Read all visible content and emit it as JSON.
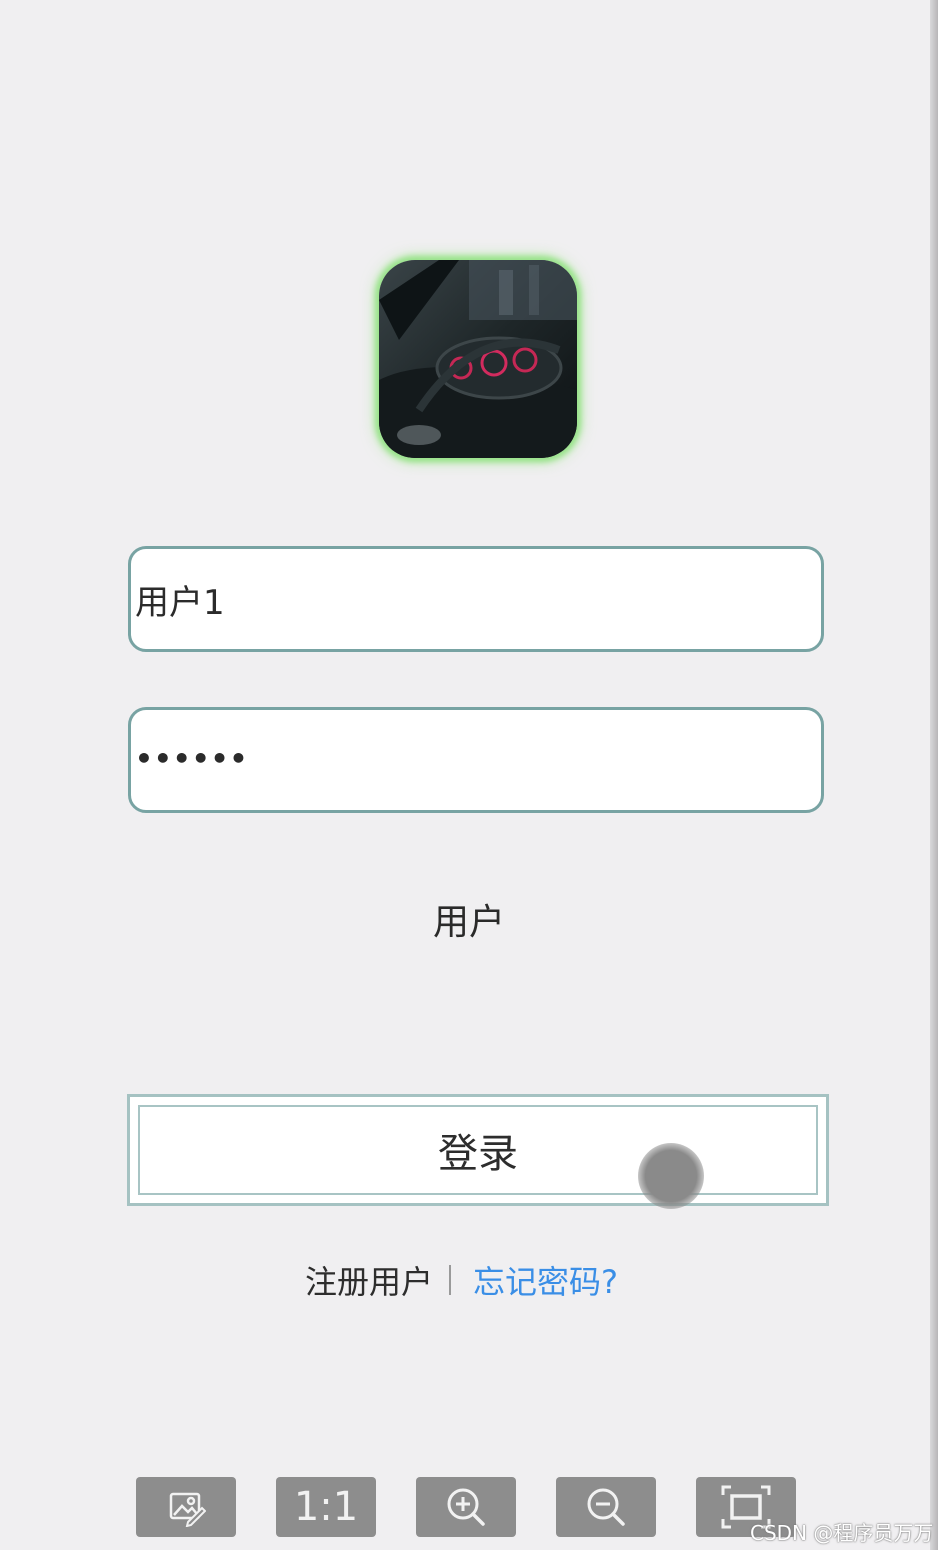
{
  "login": {
    "username_value": "用户1",
    "password_value": "••••••",
    "role_label": "用户",
    "login_button": "登录",
    "register_link": "注册用户",
    "forgot_link": "忘记密码?"
  },
  "viewer_toolbar": {
    "buttons": [
      {
        "icon": "image-edit-icon"
      },
      {
        "label": "1:1"
      },
      {
        "icon": "zoom-in-icon"
      },
      {
        "icon": "zoom-out-icon"
      },
      {
        "icon": "fit-screen-icon"
      }
    ]
  },
  "watermark": "CSDN @程序员万万",
  "colors": {
    "input_border": "#78a3a3",
    "avatar_glow": "#98e38a",
    "link_blue": "#3a8ee6",
    "toolbar_bg": "#8d8d8d",
    "page_bg": "#f0eff1"
  }
}
